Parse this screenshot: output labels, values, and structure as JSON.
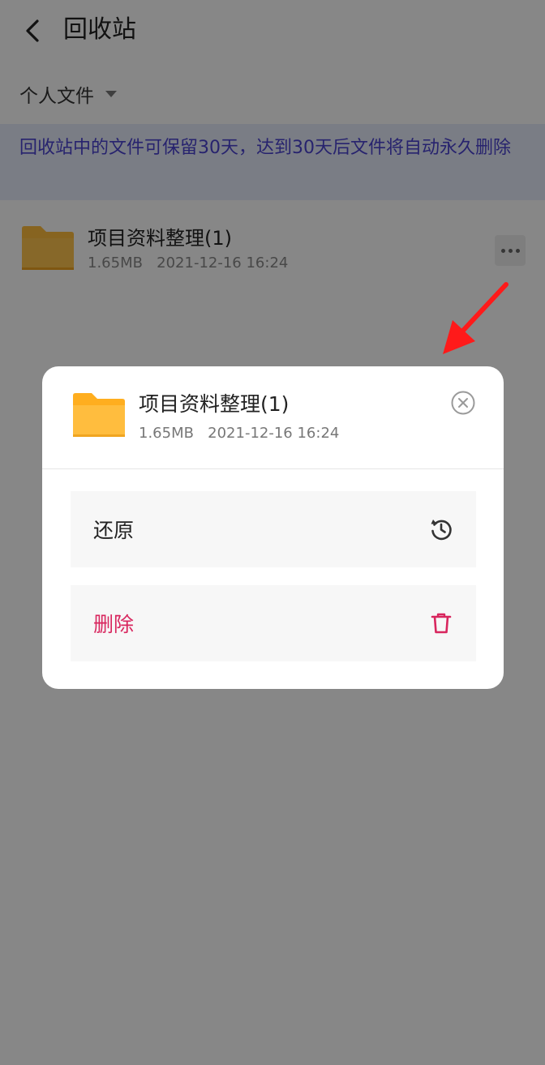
{
  "header": {
    "title": "回收站"
  },
  "filter": {
    "label": "个人文件"
  },
  "notice": {
    "text": "回收站中的文件可保留30天，达到30天后文件将自动永久删除"
  },
  "file": {
    "name": "项目资料整理(1)",
    "size": "1.65MB",
    "date": "2021-12-16 16:24"
  },
  "sheet": {
    "file_name": "项目资料整理(1)",
    "file_size": "1.65MB",
    "file_date": "2021-12-16 16:24",
    "actions": [
      {
        "label": "还原",
        "icon": "history-restore-icon"
      },
      {
        "label": "删除",
        "icon": "trash-icon",
        "color": "#d8265e"
      }
    ]
  },
  "colors": {
    "folder": "#ffbd3e",
    "notice_text": "#4b43d0",
    "notice_bg": "#e7ecfb",
    "delete": "#d8265e",
    "arrow": "#ff1a1a"
  }
}
